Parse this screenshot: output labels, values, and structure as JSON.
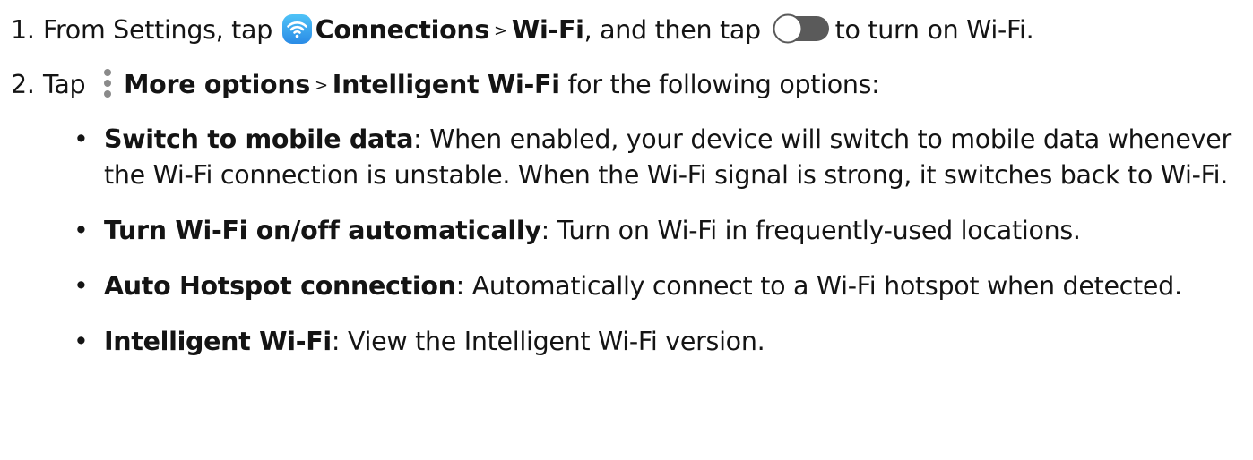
{
  "step1": {
    "number": "1.",
    "text_a": "From Settings, tap",
    "connections": "Connections",
    "sep": ">",
    "wifi": "Wi-Fi",
    "text_b": ", and then tap",
    "text_c": "to turn on Wi-Fi."
  },
  "step2": {
    "number": "2.",
    "text_a": "Tap",
    "more_options": "More options",
    "sep": ">",
    "intelligent_wifi": "Intelligent Wi-Fi",
    "text_b": "for the following options:"
  },
  "bullets": [
    {
      "title": "Switch to mobile data",
      "desc": ": When enabled, your device will switch to mobile data whenever the Wi-Fi connection is unstable. When the Wi-Fi signal is strong, it switches back to Wi-Fi."
    },
    {
      "title": "Turn Wi-Fi on/off automatically",
      "desc": ": Turn on Wi-Fi in frequently-used locations."
    },
    {
      "title": "Auto Hotspot connection",
      "desc": ": Automatically connect to a Wi-Fi hotspot when detected."
    },
    {
      "title": "Intelligent Wi-Fi",
      "desc": ": View the Intelligent Wi-Fi version."
    }
  ],
  "bullet_char": "•",
  "icons": {
    "wifi": "wifi-icon",
    "toggle": "toggle-switch-icon",
    "more": "more-options-icon"
  },
  "colors": {
    "wifi_icon_top": "#4fc3f7",
    "wifi_icon_bottom": "#2a8be6",
    "toggle_track": "#5a5a5a",
    "text": "#141414"
  }
}
